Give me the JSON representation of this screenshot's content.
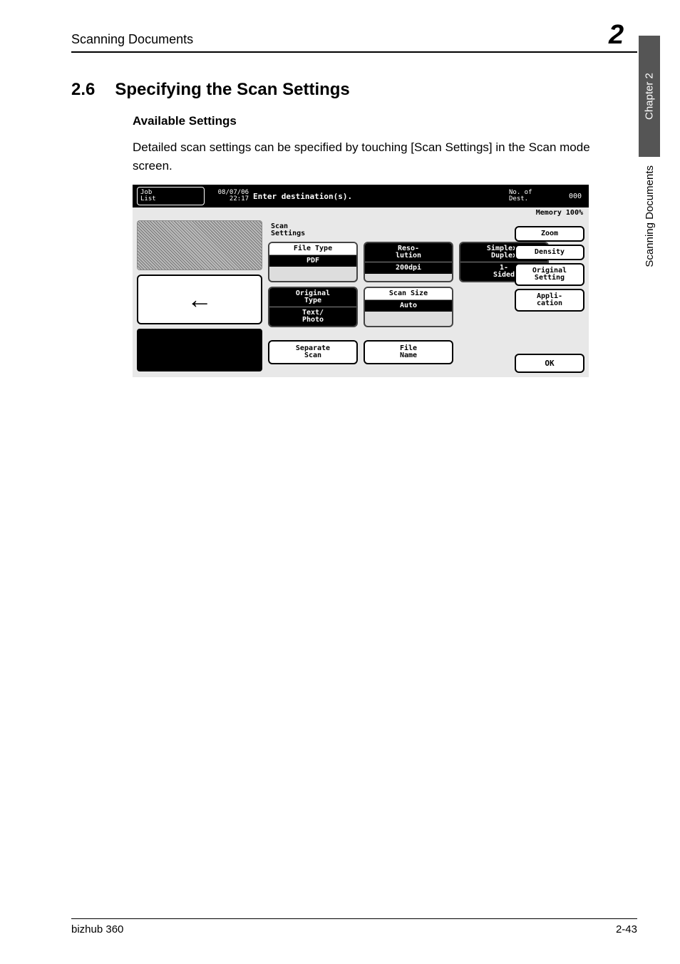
{
  "header": {
    "left": "Scanning Documents",
    "right": "2"
  },
  "section": {
    "number": "2.6",
    "title": "Specifying the Scan Settings"
  },
  "subTitle": "Available Settings",
  "bodyText": "Detailed scan settings can be specified by touching [Scan Settings] in the Scan mode screen.",
  "lcd": {
    "jobList": "Job\nList",
    "dateTime": "08/07/06\n22:17",
    "enterDest": "Enter destination(s).",
    "noDestLabel": "No. of\nDest.",
    "noDestCount": "000",
    "memory": "Memory 100%",
    "scanSettingsLabel": "Scan\nSettings",
    "groups": {
      "fileType": {
        "head": "File Type",
        "val": "PDF"
      },
      "resolution": {
        "head": "Reso-\nlution",
        "val": "200dpi"
      },
      "simplexDuplex": {
        "head": "Simplex/\nDuplex",
        "val": "1-\nSided"
      },
      "originalType": {
        "head": "Original\nType",
        "val": "Text/\nPhoto"
      },
      "scanSize": {
        "head": "Scan Size",
        "val": "Auto"
      }
    },
    "sideButtons": {
      "zoom": "Zoom",
      "density": "Density",
      "originalSetting": "Original\nSetting",
      "application": "Appli-\ncation"
    },
    "bottomChips": {
      "separateScan": "Separate\nScan",
      "fileName": "File\nName"
    },
    "ok": "OK",
    "arrowGlyph": "←"
  },
  "spine": {
    "dark": "Chapter 2",
    "light": "Scanning Documents"
  },
  "footer": {
    "left": "bizhub 360",
    "right": "2-43"
  }
}
